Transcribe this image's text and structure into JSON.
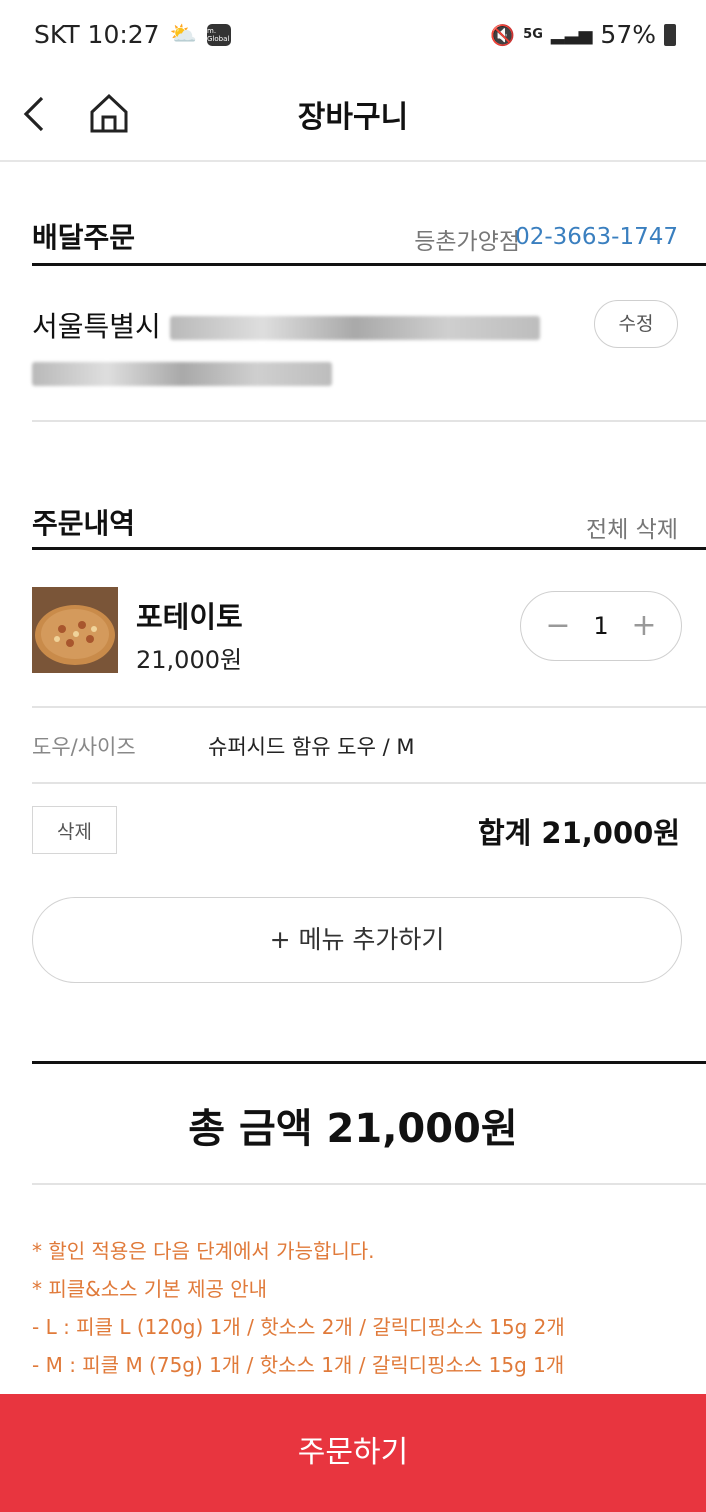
{
  "status_bar": {
    "carrier_time": "SKT 10:27",
    "app_badge": "m. Global",
    "network": "5G",
    "battery": "57%"
  },
  "header": {
    "title": "장바구니"
  },
  "delivery": {
    "section_title": "배달주문",
    "store_name": "등촌가양점",
    "store_phone": "02-3663-1747",
    "address_prefix": "서울특별시",
    "edit_label": "수정"
  },
  "order": {
    "section_title": "주문내역",
    "delete_all_label": "전체 삭제",
    "items": [
      {
        "name": "포테이토",
        "price": "21,000원",
        "quantity": "1",
        "option_label": "도우/사이즈",
        "option_value": "슈퍼시드 함유 도우 / M",
        "delete_label": "삭제",
        "subtotal": "합계 21,000원"
      }
    ],
    "add_menu_label": "+ 메뉴 추가하기"
  },
  "total": {
    "label": "총 금액 21,000원"
  },
  "notices": [
    "* 할인 적용은 다음 단계에서 가능합니다.",
    "* 피클&소스 기본 제공 안내",
    "- L : 피클 L (120g) 1개 / 핫소스 2개 / 갈릭디핑소스 15g 2개",
    "- M : 피클 M (75g) 1개 / 핫소스 1개 / 갈릭디핑소스 15g 1개"
  ],
  "colors": {
    "accent_red": "#e8353f",
    "phone_blue": "#3a7fbf",
    "notice_orange": "#e07a3a"
  },
  "order_button_label": "주문하기"
}
